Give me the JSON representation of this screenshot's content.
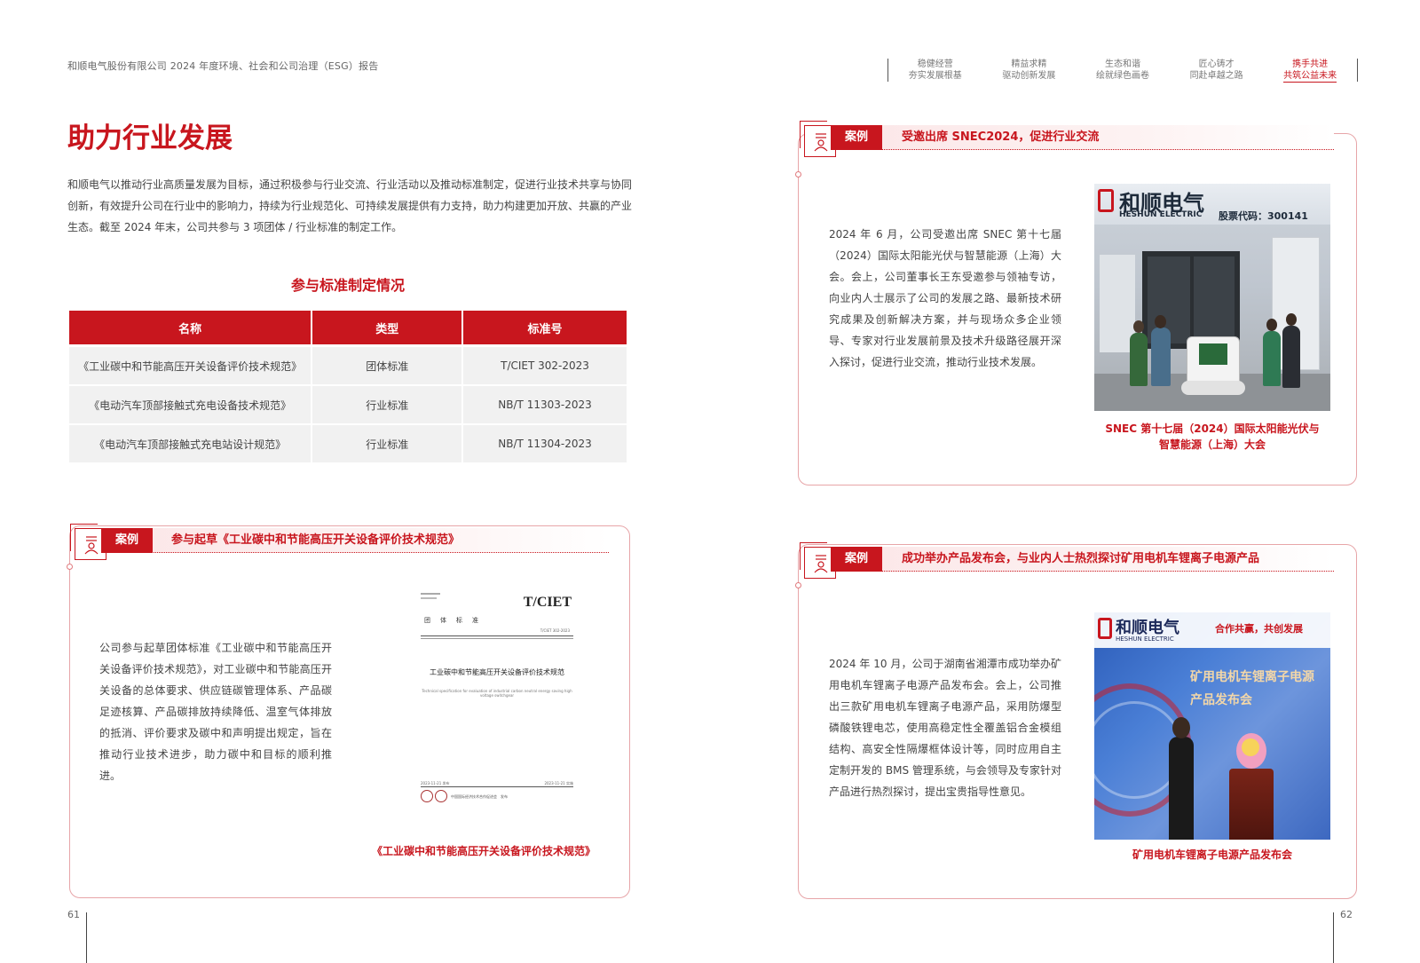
{
  "header": {
    "report_title": "和顺电气股份有限公司 2024 年度环境、社会和公司治理（ESG）报告",
    "nav": [
      {
        "line1": "稳健经营",
        "line2": "夯实发展根基"
      },
      {
        "line1": "精益求精",
        "line2": "驱动创新发展"
      },
      {
        "line1": "生态和谐",
        "line2": "绘就绿色画卷"
      },
      {
        "line1": "匠心铸才",
        "line2": "同赴卓越之路"
      },
      {
        "line1": "携手共进",
        "line2": "共筑公益未来"
      }
    ]
  },
  "left_page": {
    "heading": "助力行业发展",
    "intro": "和顺电气以推动行业高质量发展为目标，通过积极参与行业交流、行业活动以及推动标准制定，促进行业技术共享与协同创新，有效提升公司在行业中的影响力，持续为行业规范化、可持续发展提供有力支持，助力构建更加开放、共赢的产业生态。截至 2024 年末，公司共参与 3 项团体 / 行业标准的制定工作。",
    "table_title": "参与标准制定情况",
    "table": {
      "headers": [
        "名称",
        "类型",
        "标准号"
      ],
      "rows": [
        [
          "《工业碳中和节能高压开关设备评价技术规范》",
          "团体标准",
          "T/CIET 302-2023"
        ],
        [
          "《电动汽车顶部接触式充电设备技术规范》",
          "行业标准",
          "NB/T 11303-2023"
        ],
        [
          "《电动汽车顶部接触式充电站设计规范》",
          "行业标准",
          "NB/T 11304-2023"
        ]
      ]
    },
    "case1": {
      "tag": "案例",
      "title": "参与起草《工业碳中和节能高压开关设备评价技术规范》",
      "text": "公司参与起草团体标准《工业碳中和节能高压开关设备评价技术规范》，对工业碳中和节能高压开关设备的总体要求、供应链碳管理体系、产品碳足迹核算、产品碳排放持续降低、温室气体排放的抵消、评价要求及碳中和声明提出规定，旨在推动行业技术进步，助力碳中和目标的顺利推进。",
      "doc": {
        "brand": "T/CIET",
        "org_line": "团　体　标　准",
        "code_line": "T/CIET 302-2023",
        "title_cn": "工业碳中和节能高压开关设备评价技术规范",
        "title_en": "Technical specification for evaluation of industrial carbon neutral energy saving high voltage switchgear",
        "date_left": "2023-11-21 发布",
        "date_right": "2023-11-21 实施",
        "issuer": "中国国际经济技术合作促进会　发布"
      },
      "caption": "《工业碳中和节能高压开关设备评价技术规范》"
    }
  },
  "right_page": {
    "case2": {
      "tag": "案例",
      "title": "受邀出席 SNEC2024，促进行业交流",
      "text": "2024 年 6 月，公司受邀出席 SNEC 第十七届（2024）国际太阳能光伏与智慧能源（上海）大会。会上，公司董事长王东受邀参与领袖专访，向业内人士展示了公司的发展之路、最新技术研究成果及创新解决方案，并与现场众多企业领导、专家对行业发展前景及技术升级路径展开深入探讨，促进行业交流，推动行业技术发展。",
      "photo": {
        "sign_cn": "和顺电气",
        "sign_en": "HESHUN ELECTRIC",
        "stock": "股票代码：300141"
      },
      "caption_line1": "SNEC 第十七届（2024）国际太阳能光伏与",
      "caption_line2": "智慧能源（上海）大会"
    },
    "case3": {
      "tag": "案例",
      "title": "成功举办产品发布会，与业内人士热烈探讨矿用电机车锂离子电源产品",
      "text": "2024 年 10 月，公司于湖南省湘潭市成功举办矿用电机车锂离子电源产品发布会。会上，公司推出三款矿用电机车锂离子电源产品，采用防爆型磷酸铁锂电芯，使用高稳定性全覆盖铝合金模组结构、高安全性隔爆框体设计等，同时应用自主定制开发的 BMS 管理系统，与会领导及专家针对产品进行热烈探讨，提出宝贵指导性意见。",
      "photo": {
        "brand_cn": "和顺电气",
        "brand_en": "HESHUN ELECTRIC",
        "slogan": "合作共赢，共创发展",
        "banner_line1": "矿用电机车锂离子电源",
        "banner_line2": "产品发布会"
      },
      "caption": "矿用电机车锂离子电源产品发布会"
    }
  },
  "footer": {
    "left_page_number": "61",
    "right_page_number": "62"
  },
  "colors": {
    "accent": "#c8161e",
    "border": "#e7a5a8",
    "table_cell": "#f1f1f1"
  }
}
